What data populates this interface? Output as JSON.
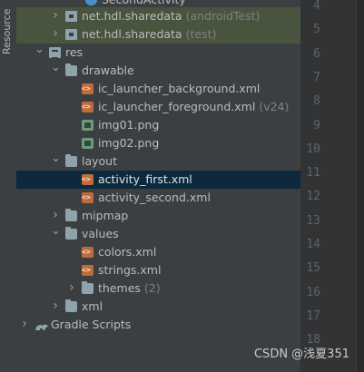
{
  "side_panel": {
    "label": "Resource"
  },
  "top_partial": {
    "label": "SecondActivity"
  },
  "tree": [
    {
      "label": "net.hdl.sharedata",
      "hint": "(androidTest)",
      "icon": "package-icon",
      "arrow": "right",
      "indent": 1,
      "highlight": true
    },
    {
      "label": "net.hdl.sharedata",
      "hint": "(test)",
      "icon": "package-icon",
      "arrow": "right",
      "indent": 1,
      "highlight": true
    },
    {
      "label": "res",
      "hint": "",
      "icon": "res-folder-icon",
      "arrow": "down",
      "indent": 0
    },
    {
      "label": "drawable",
      "hint": "",
      "icon": "folder-icon",
      "arrow": "down",
      "indent": 1
    },
    {
      "label": "ic_launcher_background.xml",
      "hint": "",
      "icon": "xml-file-icon",
      "arrow": "",
      "indent": 2
    },
    {
      "label": "ic_launcher_foreground.xml",
      "hint": "(v24)",
      "icon": "xml-file-icon",
      "arrow": "",
      "indent": 2
    },
    {
      "label": "img01.png",
      "hint": "",
      "icon": "png-file-icon",
      "arrow": "",
      "indent": 2
    },
    {
      "label": "img02.png",
      "hint": "",
      "icon": "png-file-icon",
      "arrow": "",
      "indent": 2
    },
    {
      "label": "layout",
      "hint": "",
      "icon": "folder-icon",
      "arrow": "down",
      "indent": 1
    },
    {
      "label": "activity_first.xml",
      "hint": "",
      "icon": "xml-file-icon",
      "arrow": "",
      "indent": 2,
      "selected": true
    },
    {
      "label": "activity_second.xml",
      "hint": "",
      "icon": "xml-file-icon",
      "arrow": "",
      "indent": 2
    },
    {
      "label": "mipmap",
      "hint": "",
      "icon": "folder-icon",
      "arrow": "right",
      "indent": 1
    },
    {
      "label": "values",
      "hint": "",
      "icon": "folder-icon",
      "arrow": "down",
      "indent": 1
    },
    {
      "label": "colors.xml",
      "hint": "",
      "icon": "xml-file-icon",
      "arrow": "",
      "indent": 2
    },
    {
      "label": "strings.xml",
      "hint": "",
      "icon": "xml-file-icon",
      "arrow": "",
      "indent": 2
    },
    {
      "label": "themes",
      "hint": "(2)",
      "icon": "folder-icon",
      "arrow": "right",
      "indent": 2
    },
    {
      "label": "xml",
      "hint": "",
      "icon": "folder-icon",
      "arrow": "right",
      "indent": 1
    },
    {
      "label": "Gradle Scripts",
      "hint": "",
      "icon": "gradle-icon",
      "arrow": "right",
      "indent": -1
    }
  ],
  "line_numbers": [
    "4",
    "5",
    "6",
    "7",
    "8",
    "9",
    "10",
    "11",
    "12",
    "13",
    "14",
    "15",
    "16",
    "17",
    "18"
  ],
  "watermark": "CSDN @浅夏351"
}
